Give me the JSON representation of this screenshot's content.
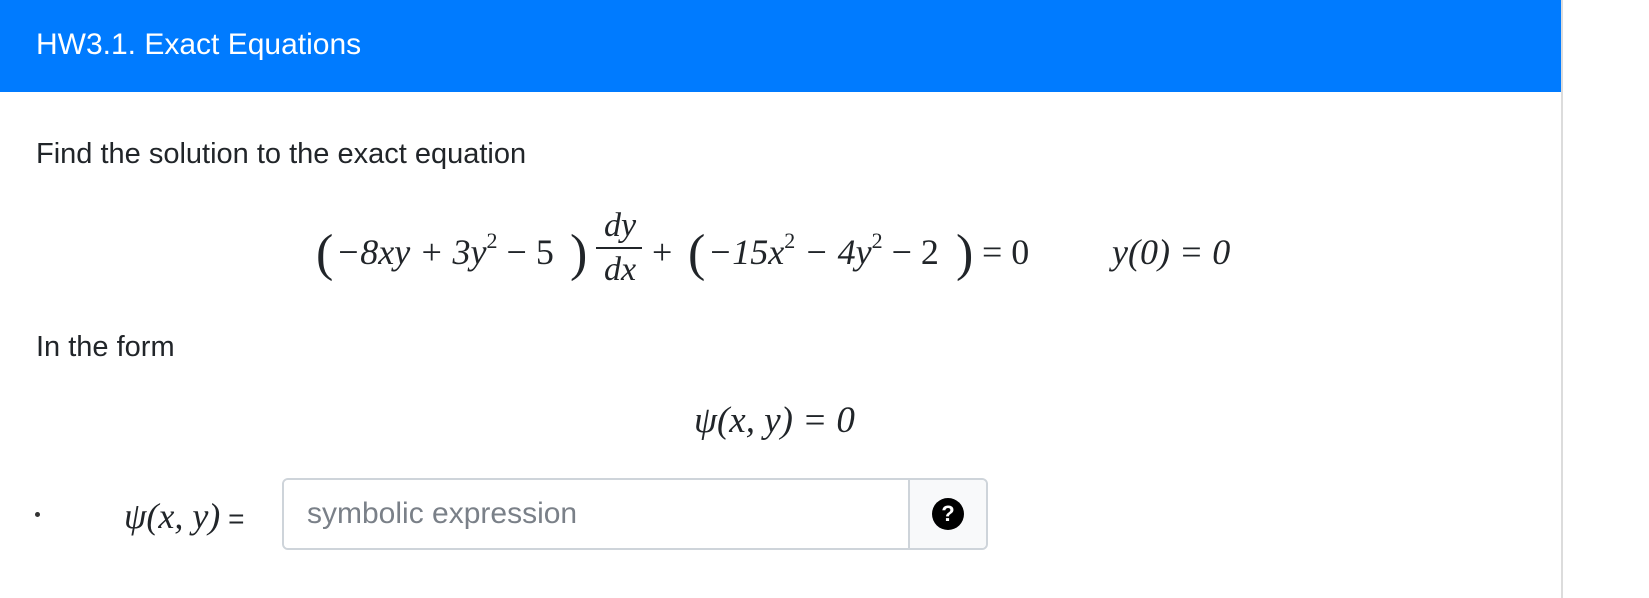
{
  "header": {
    "title": "HW3.1. Exact Equations"
  },
  "body": {
    "intro_text": "Find the solution to the exact equation",
    "form_text": "In the form",
    "equation": {
      "term1_open": "(",
      "term1": "−8xy + 3y",
      "term1_exp": "2",
      "term1_tail": " − 5",
      "term1_close": ")",
      "frac_num": "dy",
      "frac_den": "dx",
      "plus": "+",
      "term2_open": "(",
      "term2": "−15x",
      "term2_exp1": "2",
      "term2_mid": " − 4y",
      "term2_exp2": "2",
      "term2_tail": " − 2",
      "term2_close": ")",
      "equals_zero": "= 0",
      "initial_condition": "y(0) = 0"
    },
    "form_equation": "ψ(x, y) = 0",
    "answer": {
      "bullet": ".",
      "label": "ψ(x, y)",
      "equals": " =",
      "placeholder": "symbolic expression",
      "value": "",
      "help_label": "?"
    }
  },
  "colors": {
    "header_bg": "#007bff",
    "header_text": "#ffffff",
    "body_text": "#212529",
    "input_border": "#ced4da",
    "addon_bg": "#f8f9fa"
  },
  "icons": {
    "help": "question-circle-icon"
  }
}
